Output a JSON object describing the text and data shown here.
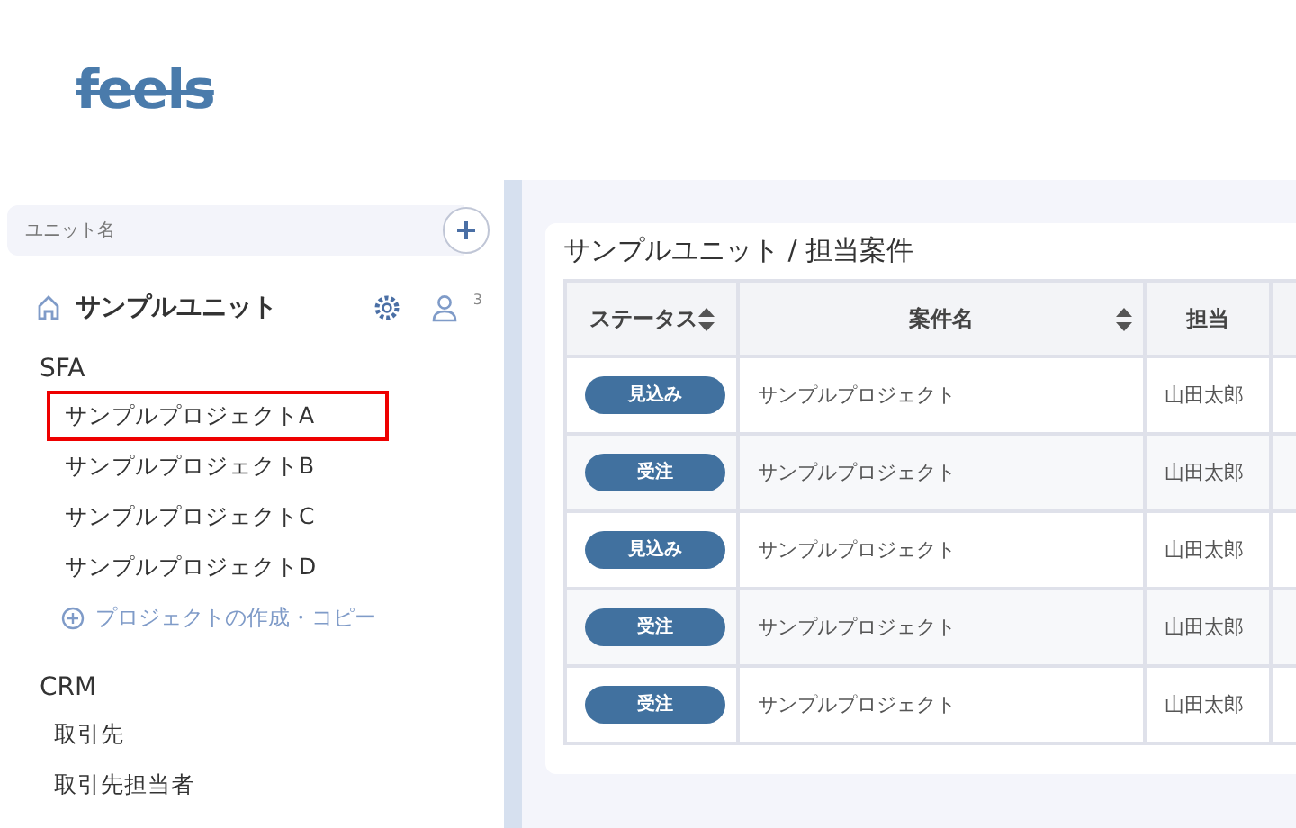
{
  "logo": "feels",
  "sidebar": {
    "unit_search": {
      "placeholder": "ユニット名"
    },
    "unit": {
      "name": "サンプルユニット",
      "member_count": "3"
    },
    "sections": [
      {
        "title": "SFA",
        "items": [
          {
            "label": "サンプルプロジェクトA",
            "selected": true
          },
          {
            "label": "サンプルプロジェクトB",
            "selected": false
          },
          {
            "label": "サンプルプロジェクトC",
            "selected": false
          },
          {
            "label": "サンプルプロジェクトD",
            "selected": false
          }
        ],
        "add_link": "プロジェクトの作成・コピー"
      },
      {
        "title": "CRM",
        "items": [
          {
            "label": "取引先",
            "selected": false
          },
          {
            "label": "取引先担当者",
            "selected": false
          }
        ]
      }
    ]
  },
  "panel": {
    "title": "サンプルユニット / 担当案件",
    "table": {
      "columns": [
        {
          "label": "ステータス",
          "sortable": true
        },
        {
          "label": "案件名",
          "sortable": true
        },
        {
          "label": "担当",
          "sortable": false
        }
      ],
      "rows": [
        {
          "status": "見込み",
          "name": "サンプルプロジェクト",
          "owner": "山田太郎"
        },
        {
          "status": "受注",
          "name": "サンプルプロジェクト",
          "owner": "山田太郎"
        },
        {
          "status": "見込み",
          "name": "サンプルプロジェクト",
          "owner": "山田太郎"
        },
        {
          "status": "受注",
          "name": "サンプルプロジェクト",
          "owner": "山田太郎"
        },
        {
          "status": "受注",
          "name": "サンプルプロジェクト",
          "owner": "山田太郎"
        }
      ]
    }
  }
}
